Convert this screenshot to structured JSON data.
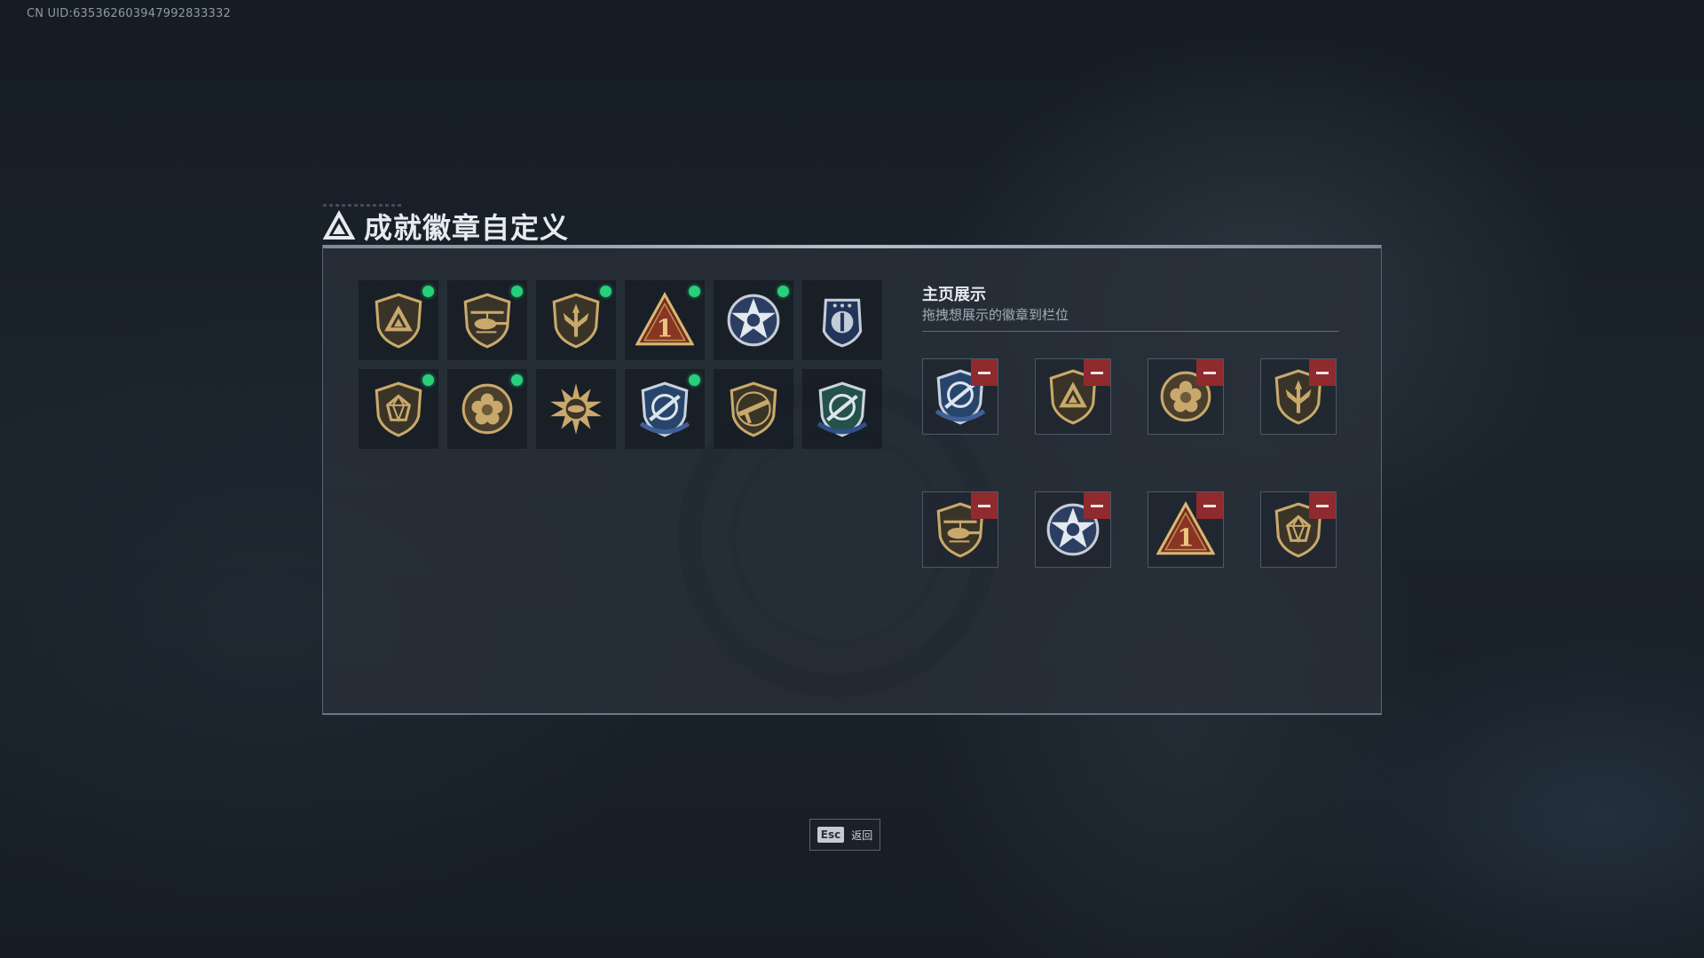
{
  "uid_label": "CN UID:635362603947992833332",
  "page": {
    "title": "成就徽章自定义"
  },
  "colors": {
    "new_dot": "#27d07b",
    "remove": "#8f2a2e",
    "gold": "#c9a96b"
  },
  "badge_grid": [
    {
      "icon": "triangle-shield-badge",
      "new": true
    },
    {
      "icon": "helicopter-badge",
      "new": true
    },
    {
      "icon": "spear-shield-badge",
      "new": true
    },
    {
      "icon": "number-one-badge",
      "new": true
    },
    {
      "icon": "star-emblem-badge",
      "new": true
    },
    {
      "icon": "blue-rank-badge",
      "new": false
    },
    {
      "icon": "gem-shield-badge",
      "new": true
    },
    {
      "icon": "flower-medal-badge",
      "new": true
    },
    {
      "icon": "sunburst-badge",
      "new": false
    },
    {
      "icon": "blue-wing-badge",
      "new": true
    },
    {
      "icon": "rifle-shield-badge",
      "new": false
    },
    {
      "icon": "green-wing-badge",
      "new": false
    }
  ],
  "showcase": {
    "title": "主页展示",
    "subtitle": "拖拽想展示的徽章到栏位",
    "slots": [
      {
        "icon": "blue-wing-badge"
      },
      {
        "icon": "triangle-shield-badge"
      },
      {
        "icon": "flower-medal-badge"
      },
      {
        "icon": "spear-shield-badge"
      },
      {
        "icon": "helicopter-badge"
      },
      {
        "icon": "star-emblem-badge"
      },
      {
        "icon": "number-one-badge"
      },
      {
        "icon": "gem-shield-badge"
      }
    ]
  },
  "footer": {
    "esc_key": "Esc",
    "back_label": "返回"
  }
}
